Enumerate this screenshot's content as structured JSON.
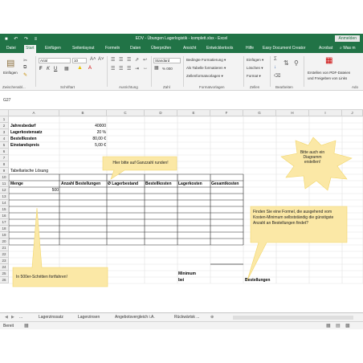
{
  "window": {
    "qat": "■ ↶ ↷ ≡",
    "title": "EDV - Übungen Lagerlogistik - komplett.xlsx - Excel",
    "login": "Anmelden"
  },
  "tabs": [
    "Datei",
    "Start",
    "Einfügen",
    "Seitenlayout",
    "Formeln",
    "Daten",
    "Überprüfen",
    "Ansicht",
    "Entwicklertools",
    "Hilfe",
    "Easy Document Creator",
    "Acrobat",
    "⌕ Was m"
  ],
  "ribbon": {
    "paste_label": "Einfügen",
    "font_name": "Arial",
    "font_size": "10",
    "bold": "F",
    "italic": "K",
    "underline": "U",
    "number_format": "Standard",
    "percent": "% 000",
    "cond_format": "Bedingte Formatierung ▾",
    "as_table": "Als Tabelle formatieren ▾",
    "cell_styles": "Zellenformatvorlagen ▾",
    "insert": "Einfügen ▾",
    "delete": "Löschen ▾",
    "format": "Format ▾",
    "pdf_line1": "Erstellen von PDF-Dateien",
    "pdf_line2": "und Freigeben von Links",
    "groups": [
      "Zwischenabl...",
      "Schriftart",
      "Ausrichtung",
      "Zahl",
      "Formatvorlagen",
      "Zellen",
      "Bearbeiten",
      "Ado"
    ]
  },
  "formula_bar": {
    "name_box": "G27",
    "content": ""
  },
  "columns": [
    "A",
    "B",
    "C",
    "D",
    "E",
    "F",
    "G",
    "H",
    "I",
    "J"
  ],
  "rows": [
    "1",
    "2",
    "3",
    "4",
    "5",
    "6",
    "7",
    "8",
    "9",
    "10",
    "11",
    "12",
    "13",
    "14",
    "15",
    "16",
    "17",
    "18",
    "19",
    "20",
    "21",
    "22",
    "23",
    "24",
    "25",
    "26"
  ],
  "cells": {
    "a1": "Jahresbedarf",
    "b1": "40000",
    "a2": "Lagerkostensatz",
    "b2": "20 %",
    "a3": "Bestellkosten",
    "b3": "80,00 €",
    "a4": "Einstandspreis",
    "b4": "5,00 €",
    "a8": "Tabellarische Lösung",
    "a10": "Menge",
    "b10": "Anzahl Bestellungen",
    "c10": "Ø Lagerbestand",
    "d10": "Bestellkosten",
    "e10": "Lagerkosten",
    "f10": "Gesamtkosten",
    "a11": "500",
    "e22": "Minimum",
    "e23": "bei",
    "g23": "Bestellungen"
  },
  "callouts": {
    "ganzzahl": "Hier bitte auf Ganzzahl runden!",
    "diagramm": "Bitte auch ein Diagramm erstellen!",
    "formel": "Finden Sie eine Formel, die ausgehend vom Kosten-Minimum selbstständig die günstigste Anzahl an Bestellungen findet?",
    "schritte": "In 500er-Schritten fortfahren!"
  },
  "sheet_tabs": [
    "Lagerzinssatz",
    "Lagerzinsen",
    "Angebotsvergleich i.A.",
    "Rückwärtsk ..."
  ],
  "status": "Bereit"
}
